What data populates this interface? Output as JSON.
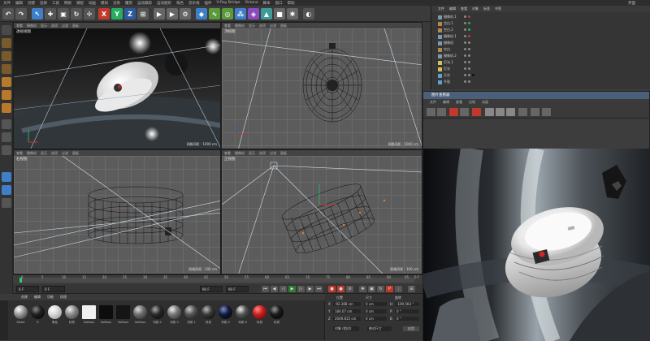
{
  "menubar": {
    "items": [
      "文件",
      "编辑",
      "创建",
      "选择",
      "工具",
      "网格",
      "捕捉",
      "动画",
      "模拟",
      "渲染",
      "雕刻",
      "运动跟踪",
      "运动图形",
      "角色",
      "流水线",
      "插件",
      "V-Ray Bridge",
      "Octane",
      "脚本",
      "窗口",
      "帮助"
    ],
    "right": "界面"
  },
  "toolbar": {
    "colors": {
      "accent": "#3f7fc8",
      "x": "#c0392b",
      "y": "#27ae60",
      "z": "#2c5aa0"
    }
  },
  "viewports": [
    {
      "id": "perspective",
      "name": "透视视图",
      "menu": [
        "查看",
        "摄像机",
        "显示",
        "选项",
        "过滤",
        "面板"
      ],
      "grid": "网格间距 : 1000 cm"
    },
    {
      "id": "top",
      "name": "顶视图",
      "menu": [
        "查看",
        "摄像机",
        "显示",
        "选项",
        "过滤",
        "面板"
      ],
      "grid": "网格间距 : 1000 cm"
    },
    {
      "id": "right",
      "name": "右视图",
      "menu": [
        "查看",
        "摄像机",
        "显示",
        "选项",
        "过滤",
        "面板"
      ],
      "grid": "网格间距 : 100 cm"
    },
    {
      "id": "front",
      "name": "正视图",
      "menu": [
        "查看",
        "摄像机",
        "显示",
        "选项",
        "过滤",
        "面板"
      ],
      "grid": "网格间距 : 100 cm"
    }
  ],
  "timeline": {
    "ticks": [
      "0",
      "5",
      "10",
      "15",
      "20",
      "25",
      "30",
      "35",
      "40",
      "45",
      "50",
      "55",
      "60",
      "65",
      "70",
      "75",
      "80",
      "85",
      "90",
      "95"
    ],
    "end_label": "0 F"
  },
  "playbar": {
    "start": "0 F",
    "current": "0 F",
    "end": "90 F",
    "max": "90 F"
  },
  "materials": {
    "menu": [
      "创建",
      "编辑",
      "功能",
      "纹理"
    ],
    "items": [
      {
        "label": "Metal",
        "color": "#9a9a9a"
      },
      {
        "label": "R",
        "color": "#202020"
      },
      {
        "label": "黑色",
        "color": "#d8d8d8"
      },
      {
        "label": "材质",
        "color": "#8a8a8a"
      },
      {
        "label": "Softbox",
        "color": "#f0f0f0"
      },
      {
        "label": "Softbox",
        "color": "#0d0d0d"
      },
      {
        "label": "Softbox",
        "color": "#151515"
      },
      {
        "label": "Softbox",
        "color": "#6e6e6e"
      },
      {
        "label": "材质.4",
        "color": "#2a2a2a"
      },
      {
        "label": "材质.3",
        "color": "#777777"
      },
      {
        "label": "材质.1",
        "color": "#555555"
      },
      {
        "label": "材质",
        "color": "#3a3a3a"
      },
      {
        "label": "材质.5",
        "color": "#141a3a"
      },
      {
        "label": "材质.6",
        "color": "#555555"
      },
      {
        "label": "材质",
        "color": "#cc1f1f"
      },
      {
        "label": "材质",
        "color": "#1a1a1a"
      }
    ]
  },
  "coords": {
    "headers": [
      "位置",
      "尺寸",
      "旋转"
    ],
    "rows": [
      {
        "axis": "X",
        "pos": "-92.368 cm",
        "size": "0 cm",
        "rotl": "H",
        "rot": "-109.564 °"
      },
      {
        "axis": "Y",
        "pos": "184.07 cm",
        "size": "0 cm",
        "rotl": "P",
        "rot": "0 °"
      },
      {
        "axis": "Z",
        "pos": "2049.815 cm",
        "size": "0 cm",
        "rotl": "B",
        "rot": "0 °"
      }
    ],
    "mode": "对象 (相对)",
    "size_mode": "绝对尺寸",
    "apply": "应用"
  },
  "object_manager": {
    "menu": [
      "文件",
      "编辑",
      "查看",
      "对象",
      "标签",
      "书签"
    ],
    "objects": [
      "摄像机.1",
      "空白.1",
      "空白.2",
      "摄像机.1",
      "摄像机",
      "空白",
      "摄像机.2",
      "灯光.1",
      "灯光",
      "天空",
      "平面"
    ]
  },
  "picture_viewer": {
    "title": "图片查看器",
    "menu": [
      "文件",
      "编辑",
      "查看",
      "比较",
      "动画"
    ]
  }
}
